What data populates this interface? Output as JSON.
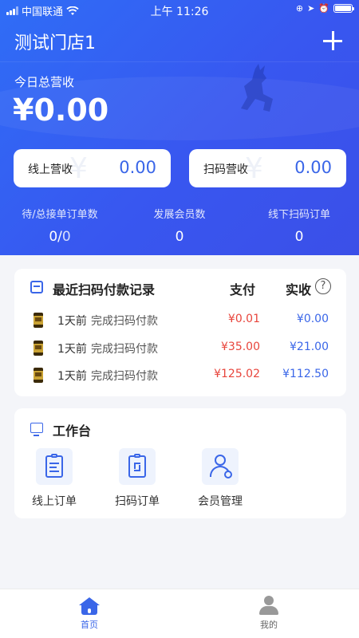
{
  "status_bar": {
    "carrier": "中国联通",
    "time": "上午 11:26"
  },
  "header": {
    "store_name": "测试门店1",
    "revenue_label": "今日总营收",
    "revenue_value": "¥0.00"
  },
  "cards": [
    {
      "label": "线上营收",
      "value": "0.00"
    },
    {
      "label": "扫码营收",
      "value": "0.00"
    }
  ],
  "stats": [
    {
      "label": "待/总接单订单数",
      "value_a": "0/",
      "value_b": "0"
    },
    {
      "label": "发展会员数",
      "value": "0"
    },
    {
      "label": "线下扫码订单",
      "value": "0"
    }
  ],
  "records": {
    "title": "最近扫码付款记录",
    "col_pay": "支付",
    "col_received": "实收",
    "help_symbol": "?",
    "rows": [
      {
        "time": "1天前",
        "desc": "完成扫码付款",
        "pay": "¥0.01",
        "received": "¥0.00"
      },
      {
        "time": "1天前",
        "desc": "完成扫码付款",
        "pay": "¥35.00",
        "received": "¥21.00"
      },
      {
        "time": "1天前",
        "desc": "完成扫码付款",
        "pay": "¥125.02",
        "received": "¥112.50"
      }
    ]
  },
  "workbench": {
    "title": "工作台",
    "tools": [
      {
        "label": "线上订单",
        "icon": "online-order-icon"
      },
      {
        "label": "扫码订单",
        "icon": "scan-order-icon"
      },
      {
        "label": "会员管理",
        "icon": "member-manage-icon"
      }
    ]
  },
  "tabbar": {
    "tabs": [
      {
        "label": "首页",
        "icon": "home-icon",
        "active": true
      },
      {
        "label": "我的",
        "icon": "profile-icon",
        "active": false
      }
    ]
  },
  "colors": {
    "accent": "#3a66e8",
    "pay_red": "#e8453c",
    "header_blue": "#3857f0"
  }
}
